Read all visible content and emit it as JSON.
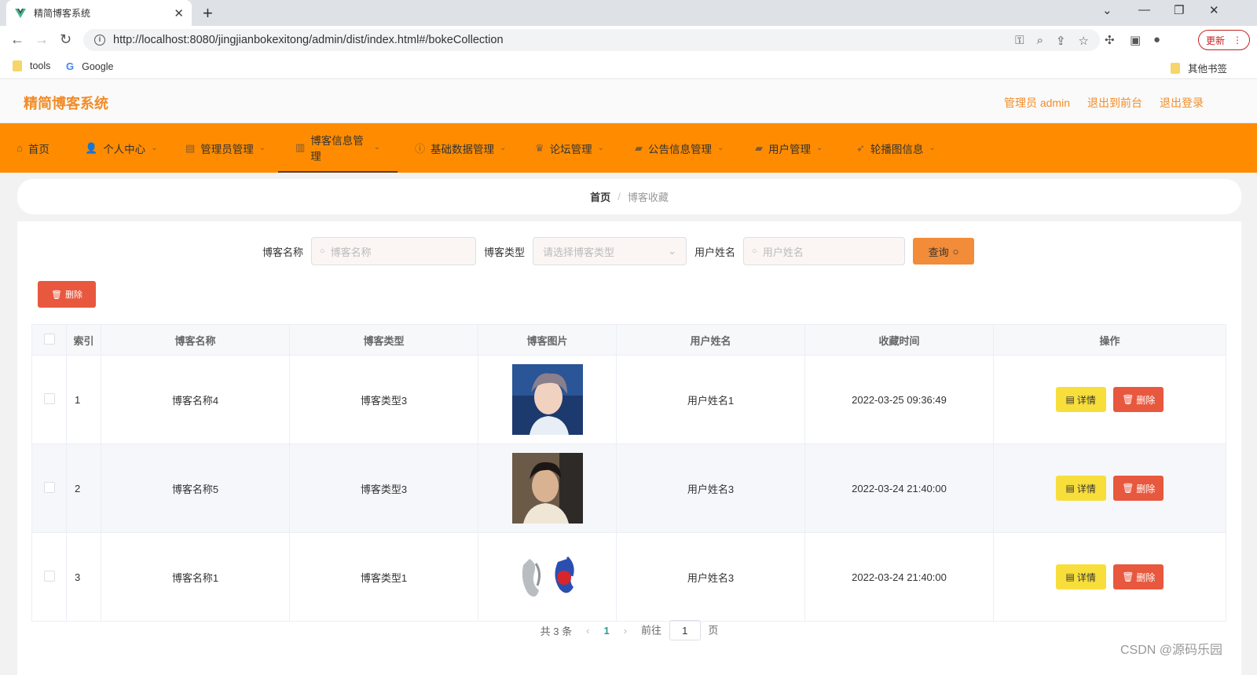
{
  "browser": {
    "tab_title": "精简博客系统",
    "url": "http://localhost:8080/jingjianbokexitong/admin/dist/index.html#/bokeCollection",
    "update_label": "更新",
    "bookmarks": [
      "tools",
      "Google"
    ],
    "other_bookmarks": "其他书签"
  },
  "header": {
    "logo": "精简博客系统",
    "admin_label": "管理员 admin",
    "to_front": "退出到前台",
    "logout": "退出登录"
  },
  "menu": [
    {
      "label": "首页"
    },
    {
      "label": "个人中心"
    },
    {
      "label": "管理员管理"
    },
    {
      "label": "博客信息管理"
    },
    {
      "label": "基础数据管理"
    },
    {
      "label": "论坛管理"
    },
    {
      "label": "公告信息管理"
    },
    {
      "label": "用户管理"
    },
    {
      "label": "轮播图信息"
    }
  ],
  "breadcrumb": {
    "home": "首页",
    "separator": "/",
    "current": "博客收藏"
  },
  "search": {
    "name_label": "博客名称",
    "name_placeholder": "博客名称",
    "type_label": "博客类型",
    "type_placeholder": "请选择博客类型",
    "user_label": "用户姓名",
    "user_placeholder": "用户姓名",
    "query_button": "查询"
  },
  "batch_delete": "删除",
  "table": {
    "headers": [
      "索引",
      "博客名称",
      "博客类型",
      "博客图片",
      "用户姓名",
      "收藏时间",
      "操作"
    ],
    "rows": [
      {
        "index": "1",
        "name": "博客名称4",
        "type": "博客类型3",
        "user": "用户姓名1",
        "time": "2022-03-25 09:36:49"
      },
      {
        "index": "2",
        "name": "博客名称5",
        "type": "博客类型3",
        "user": "用户姓名3",
        "time": "2022-03-24 21:40:00"
      },
      {
        "index": "3",
        "name": "博客名称1",
        "type": "博客类型1",
        "user": "用户姓名3",
        "time": "2022-03-24 21:40:00"
      }
    ],
    "detail_label": "详情",
    "delete_label": "删除"
  },
  "pagination": {
    "total": "共 3 条",
    "current": "1",
    "goto_label": "前往",
    "goto_value": "1",
    "page_suffix": "页"
  },
  "watermark": "CSDN @源码乐园",
  "colors": {
    "menu_bg": "#ff8c00",
    "accent": "#f28c28",
    "danger": "#e8583e",
    "warning": "#f8de3b"
  }
}
